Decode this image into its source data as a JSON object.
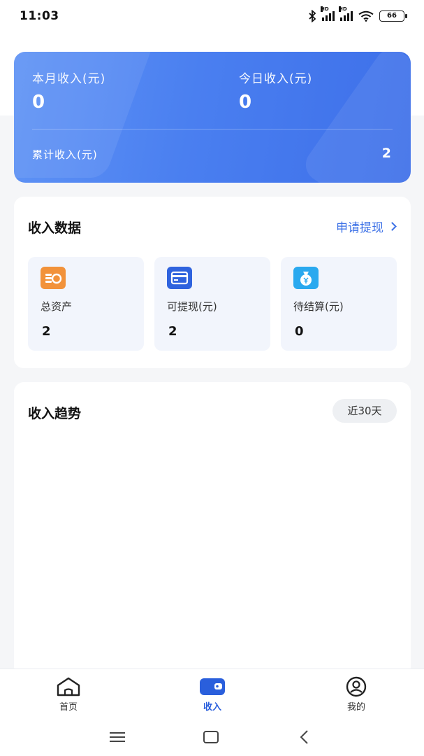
{
  "status_bar": {
    "time": "11:03",
    "icons": [
      "bluetooth-icon",
      "signal-hd-icon",
      "signal-hd-icon",
      "wifi-icon",
      "battery-icon"
    ],
    "hd_label": "HD",
    "battery": "66"
  },
  "income_summary": {
    "month_label": "本月收入(元)",
    "month_value": "0",
    "today_label": "今日收入(元)",
    "today_value": "0",
    "total_label": "累计收入(元)",
    "total_value": "2",
    "accent": "#4a7ff0"
  },
  "income_data": {
    "title": "收入数据",
    "withdraw_link": "申请提现",
    "stats": [
      {
        "label": "总资产",
        "value": "2",
        "icon": "coins-icon",
        "color": "#f2923a"
      },
      {
        "label": "可提现(元)",
        "value": "2",
        "icon": "card-icon",
        "color": "#2f63de"
      },
      {
        "label": "待结算(元)",
        "value": "0",
        "icon": "money-bag-icon",
        "color": "#2aa9ef"
      }
    ]
  },
  "income_trend": {
    "title": "收入趋势",
    "range": "近30天"
  },
  "tabbar": {
    "items": [
      {
        "label": "首页",
        "icon": "home-icon",
        "active": false
      },
      {
        "label": "收入",
        "icon": "wallet-icon",
        "active": true
      },
      {
        "label": "我的",
        "icon": "profile-icon",
        "active": false
      }
    ],
    "active_color": "#2a5fdc"
  },
  "system_nav": [
    "menu-icon",
    "home-square-icon",
    "back-icon"
  ]
}
